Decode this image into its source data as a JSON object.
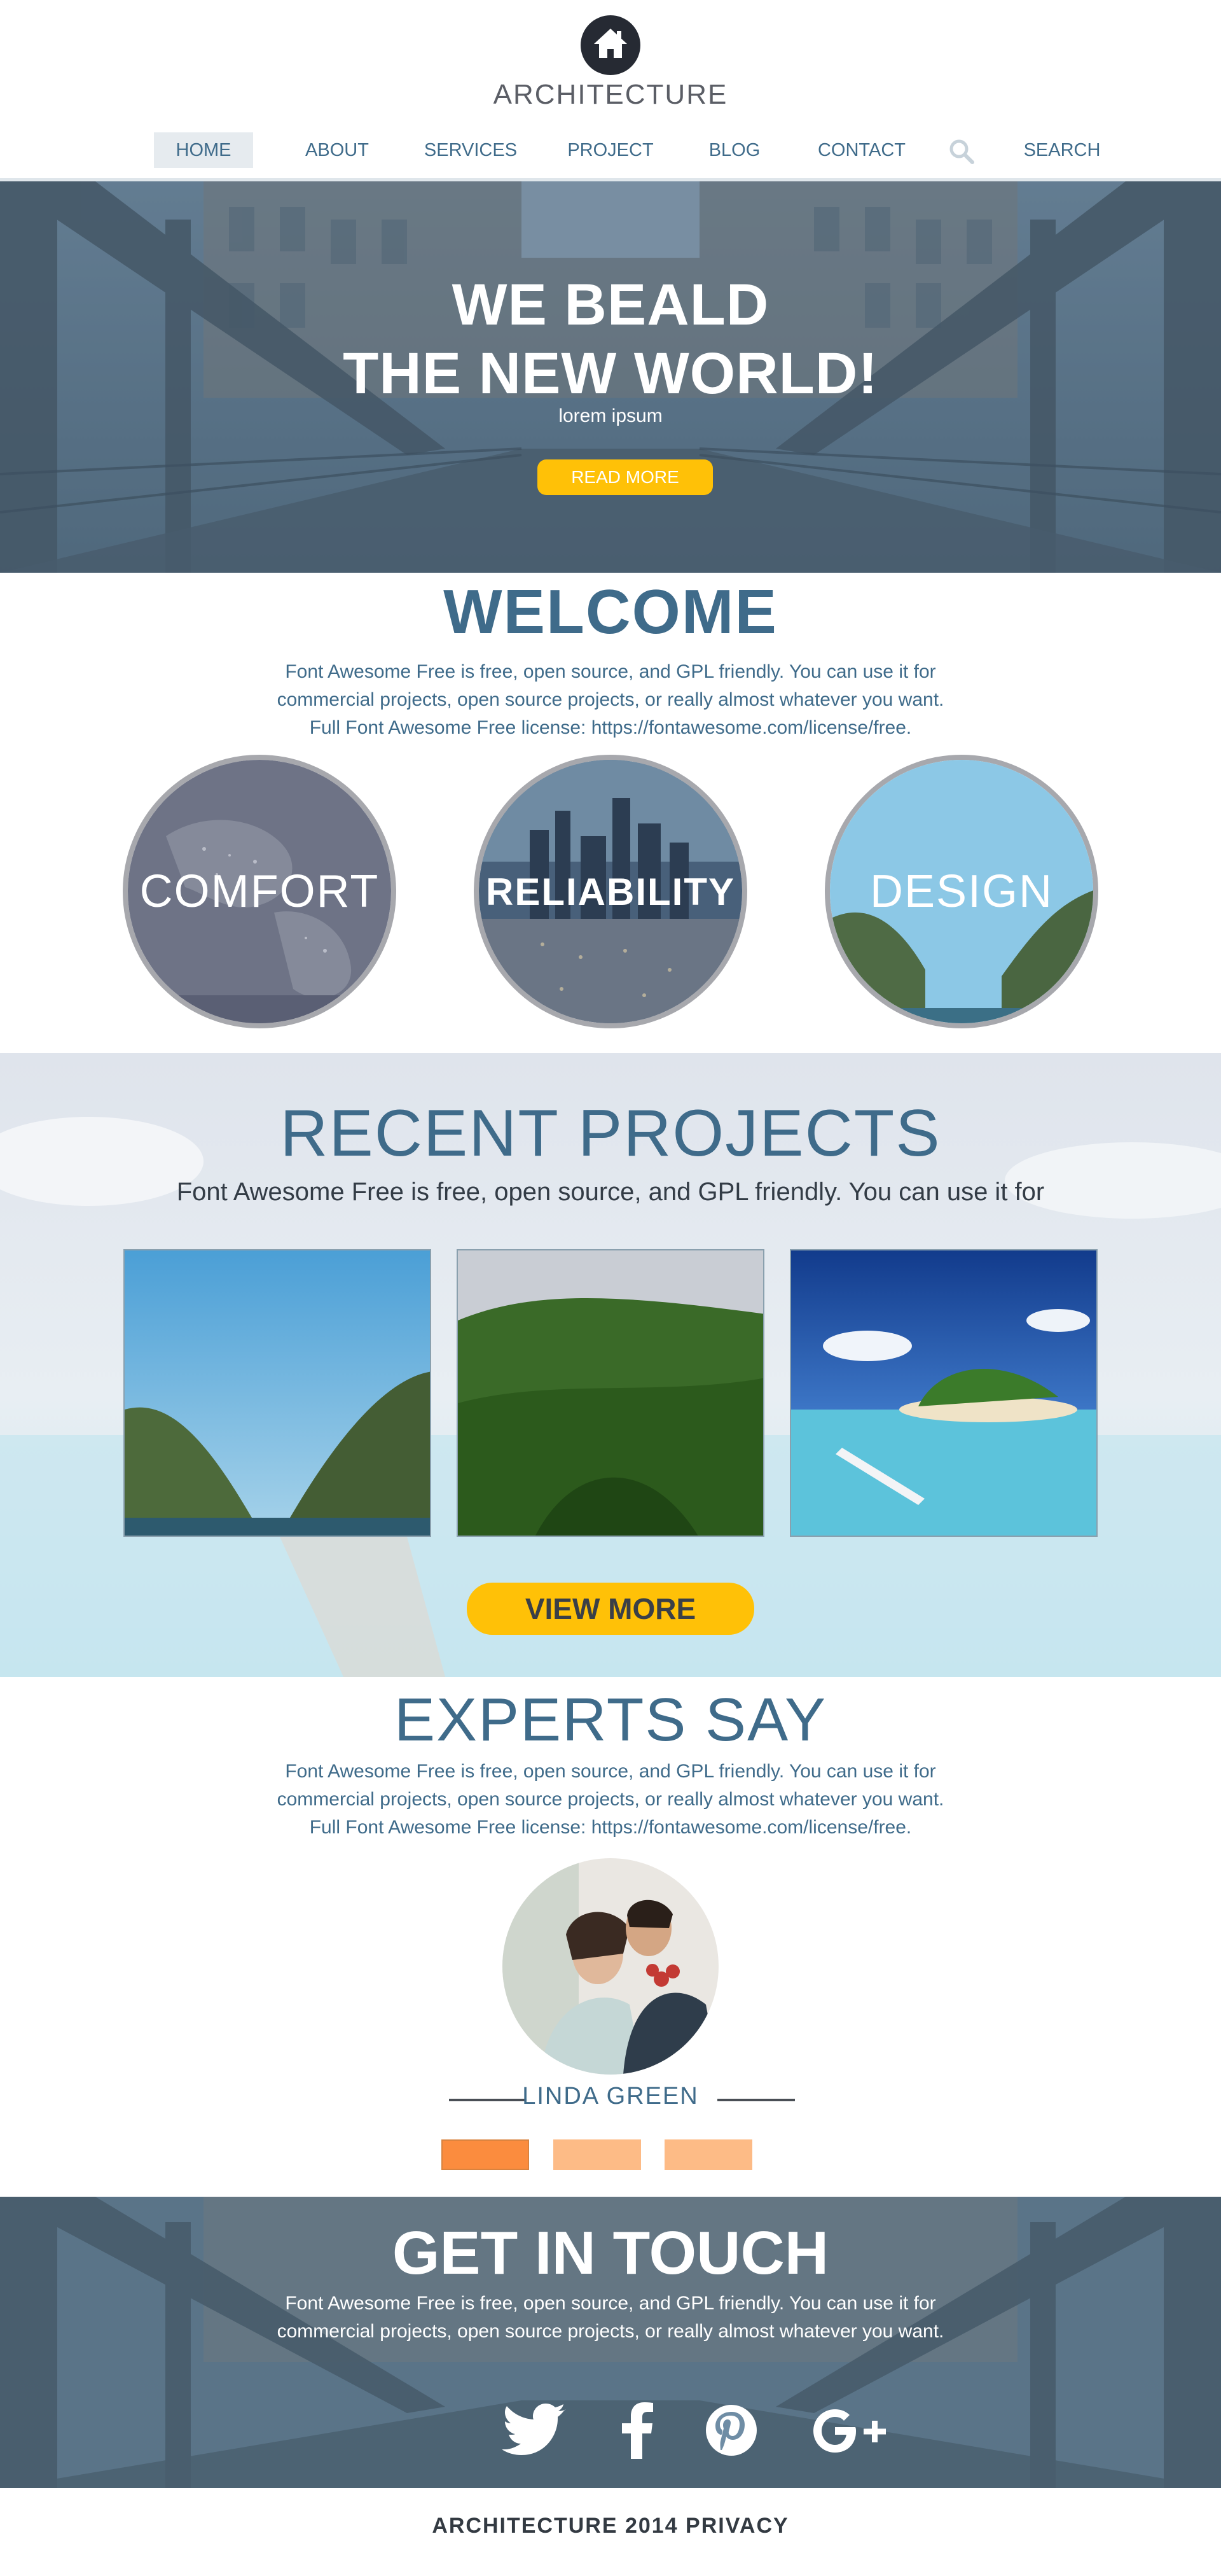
{
  "brand": {
    "name": "ARCHITECTURE"
  },
  "nav": {
    "items": [
      {
        "label": "HOME",
        "active": true
      },
      {
        "label": "ABOUT"
      },
      {
        "label": "SERVICES"
      },
      {
        "label": "PROJECT"
      },
      {
        "label": "BLOG"
      },
      {
        "label": "CONTACT"
      }
    ],
    "search_label": "SEARCH",
    "search_icon": "search-icon"
  },
  "hero": {
    "title_line1": "WE BEALD",
    "title_line2": "THE NEW WORLD!",
    "subtitle": "lorem ipsum",
    "button": "READ MORE"
  },
  "welcome": {
    "title": "WELCOME",
    "lines": [
      "Font Awesome Free is free, open source, and GPL friendly. You can use it for",
      "commercial projects, open source projects, or really almost whatever you want.",
      "Full Font Awesome Free license: https://fontawesome.com/license/free."
    ],
    "circles": [
      {
        "label": "COMFORT"
      },
      {
        "label": "RELIABILITY"
      },
      {
        "label": "DESIGN"
      }
    ]
  },
  "recent": {
    "title": "RECENT PROJECTS",
    "subtitle": "Font Awesome Free is free, open source, and GPL friendly. You can use it for",
    "button": "VIEW MORE"
  },
  "experts": {
    "title": "EXPERTS SAY",
    "lines": [
      "Font Awesome Free is free, open source, and GPL friendly. You can use it for",
      "commercial projects, open source projects, or really almost whatever you want.",
      "Full Font Awesome Free license: https://fontawesome.com/license/free."
    ],
    "name": "LINDA GREEN"
  },
  "touch": {
    "title": "GET IN TOUCH",
    "lines": [
      "Font Awesome Free is free, open source, and GPL friendly. You can use it for",
      "commercial projects, open source projects, or really almost whatever you want."
    ],
    "social": [
      "twitter-icon",
      "facebook-icon",
      "pinterest-icon",
      "google-plus-icon"
    ]
  },
  "footer": {
    "text": "ARCHITECTURE 2014  PRIVACY"
  },
  "colors": {
    "accent": "#ffc107",
    "primary_text": "#3f6b8a",
    "dot_active": "#fb8c3e",
    "dot_inactive": "#fdbb86"
  }
}
